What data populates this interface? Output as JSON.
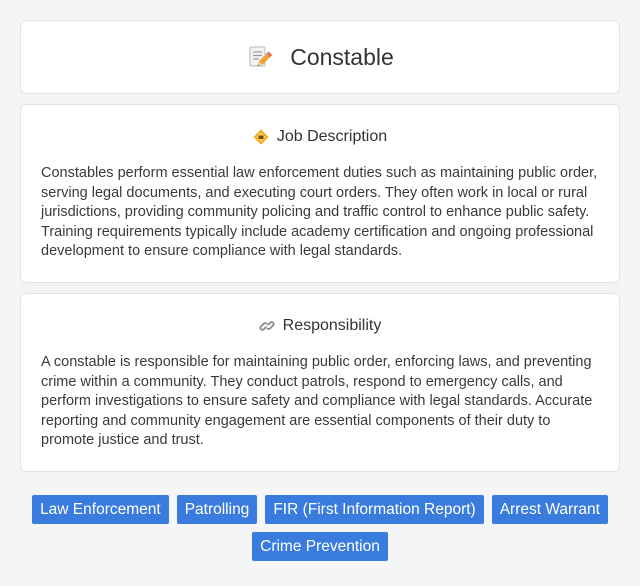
{
  "header": {
    "title": "Constable",
    "icon": "memo-pencil-icon"
  },
  "sections": [
    {
      "heading": "Job Description",
      "icon": "badge-icon",
      "body": "Constables perform essential law enforcement duties such as maintaining public order, serving legal documents, and executing court orders. They often work in local or rural jurisdictions, providing community policing and traffic control to enhance public safety. Training requirements typically include academy certification and ongoing professional development to ensure compliance with legal standards."
    },
    {
      "heading": "Responsibility",
      "icon": "link-icon",
      "body": "A constable is responsible for maintaining public order, enforcing laws, and preventing crime within a community. They conduct patrols, respond to emergency calls, and perform investigations to ensure safety and compliance with legal standards. Accurate reporting and community engagement are essential components of their duty to promote justice and trust."
    }
  ],
  "tags": [
    "Law Enforcement",
    "Patrolling",
    "FIR (First Information Report)",
    "Arrest Warrant",
    "Crime Prevention"
  ],
  "colors": {
    "tag_bg": "#3a7bde",
    "card_bg": "#ffffff",
    "page_bg": "#f4f5f7"
  }
}
